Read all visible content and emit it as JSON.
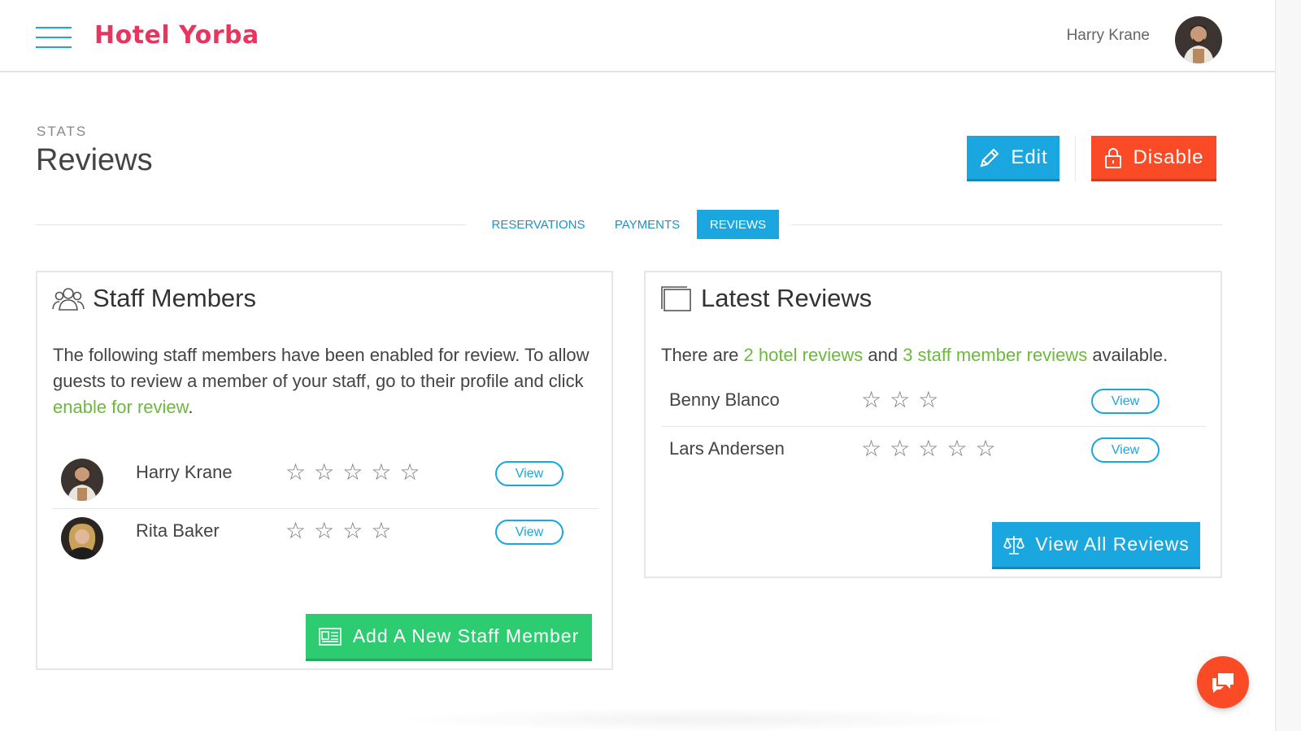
{
  "header": {
    "brand": "Hotel Yorba",
    "user_name": "Harry Krane",
    "menu_icon": "hamburger-menu-icon"
  },
  "page": {
    "breadcrumb": "STATS",
    "title": "Reviews",
    "edit_label": "Edit",
    "disable_label": "Disable"
  },
  "tabs": [
    {
      "label": "RESERVATIONS",
      "active": false
    },
    {
      "label": "PAYMENTS",
      "active": false
    },
    {
      "label": "REVIEWS",
      "active": true
    }
  ],
  "staff_card": {
    "title": "Staff Members",
    "intro_text": "The following staff members have been enabled for review. To allow guests to review a member of your staff, go to their profile and click ",
    "intro_link": "enable for review",
    "intro_end": ".",
    "members": [
      {
        "name": "Harry Krane",
        "stars": 5,
        "view_label": "View"
      },
      {
        "name": "Rita Baker",
        "stars": 4,
        "view_label": "View"
      }
    ],
    "add_label": "Add A New Staff Member"
  },
  "reviews_card": {
    "title": "Latest Reviews",
    "intro_a": "There are ",
    "hotel_link": "2 hotel reviews",
    "intro_b": " and ",
    "staff_link": "3 staff member reviews",
    "intro_c": " available.",
    "reviews": [
      {
        "name": "Benny Blanco",
        "stars": 3,
        "view_label": "View"
      },
      {
        "name": "Lars Andersen",
        "stars": 5,
        "view_label": "View"
      }
    ],
    "view_all_label": "View All Reviews"
  },
  "colors": {
    "accent": "#1aa7e0",
    "danger": "#fb4a26",
    "success": "#2ecc71",
    "brand": "#e8355f",
    "link": "#6cb93c"
  }
}
